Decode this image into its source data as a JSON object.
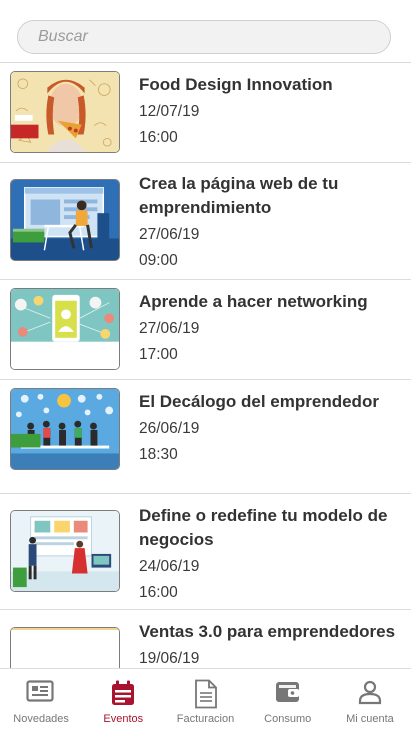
{
  "search": {
    "placeholder": "Buscar",
    "value": ""
  },
  "events": [
    {
      "title": "Food Design Innovation",
      "date": "12/07/19",
      "time": "16:00"
    },
    {
      "title": "Crea la página web de tu emprendimiento",
      "date": "27/06/19",
      "time": "09:00"
    },
    {
      "title": "Aprende a hacer networking",
      "date": "27/06/19",
      "time": "17:00"
    },
    {
      "title": "El Decálogo del emprendedor",
      "date": "26/06/19",
      "time": "18:30"
    },
    {
      "title": "Define o redefine tu modelo de negocios",
      "date": "24/06/19",
      "time": "16:00"
    },
    {
      "title": "Ventas 3.0 para emprendedores",
      "date": "19/06/19",
      "time": ""
    }
  ],
  "tabs": [
    {
      "label": "Novedades",
      "icon": "newspaper-icon",
      "active": false
    },
    {
      "label": "Eventos",
      "icon": "calendar-icon",
      "active": true
    },
    {
      "label": "Facturacion",
      "icon": "document-icon",
      "active": false
    },
    {
      "label": "Consumo",
      "icon": "wallet-icon",
      "active": false
    },
    {
      "label": "Mi cuenta",
      "icon": "user-icon",
      "active": false
    }
  ],
  "colors": {
    "accent": "#a8142f",
    "inactive": "#777777",
    "text": "#333333"
  }
}
